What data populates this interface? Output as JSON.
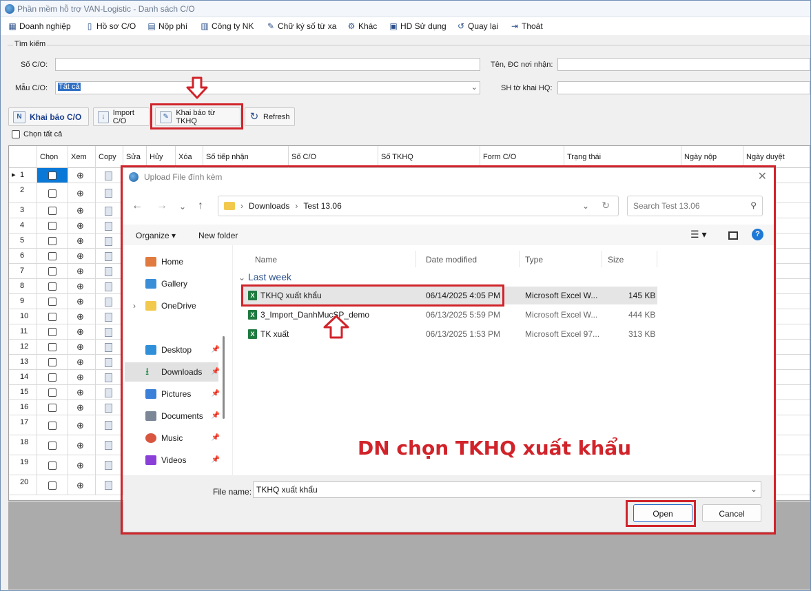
{
  "app": {
    "title": "Phần mềm hỗ trợ VAN-Logistic - Danh sách C/O",
    "menu": [
      "Doanh nghiệp",
      "Hồ sơ C/O",
      "Nộp phí",
      "Công ty NK",
      "Chữ ký số từ xa",
      "Khác",
      "HD Sử dụng",
      "Quay lại",
      "Thoát"
    ]
  },
  "search": {
    "legend": "Tìm kiếm",
    "so_co_label": "Số C/O:",
    "mau_co_label": "Mẫu C/O:",
    "mau_co_value": "Tất cả",
    "ten_dc_label": "Tên, ĐC nơi nhận:",
    "sh_tokhai_label": "SH tờ khai HQ:"
  },
  "toolbar": {
    "khai_bao": "Khai báo C/O",
    "import": "Import C/O",
    "khai_bao_tkhq": "Khai báo từ TKHQ",
    "refresh": "Refresh",
    "chon_tat_ca": "Chọn tất cả"
  },
  "grid": {
    "columns": [
      "Chọn",
      "Xem",
      "Copy",
      "Sửa",
      "Hủy",
      "Xóa",
      "Số tiếp nhận",
      "Số C/O",
      "Số TKHQ",
      "Form C/O",
      "Trạng thái",
      "Ngày nộp",
      "Ngày duyệt"
    ],
    "rows": [
      "1",
      "2",
      "3",
      "4",
      "5",
      "6",
      "7",
      "8",
      "9",
      "10",
      "11",
      "12",
      "13",
      "14",
      "15",
      "16",
      "17",
      "18",
      "19",
      "20"
    ]
  },
  "dialog": {
    "title": "Upload File đính kèm",
    "path": [
      "Downloads",
      "Test 13.06"
    ],
    "search_placeholder": "Search Test 13.06",
    "organize": "Organize",
    "new_folder": "New folder",
    "nav": [
      {
        "label": "Home",
        "icon": "home-icon"
      },
      {
        "label": "Gallery",
        "icon": "gallery-icon"
      },
      {
        "label": "OneDrive",
        "icon": "folder-icon"
      },
      {
        "label": "Desktop",
        "icon": "desktop-icon"
      },
      {
        "label": "Downloads",
        "icon": "download-icon"
      },
      {
        "label": "Pictures",
        "icon": "pictures-icon"
      },
      {
        "label": "Documents",
        "icon": "documents-icon"
      },
      {
        "label": "Music",
        "icon": "music-icon"
      },
      {
        "label": "Videos",
        "icon": "videos-icon"
      }
    ],
    "columns": [
      "Name",
      "Date modified",
      "Type",
      "Size"
    ],
    "group": "Last week",
    "files": [
      {
        "name": "TKHQ xuất khẩu",
        "date": "06/14/2025 4:05 PM",
        "type": "Microsoft Excel W...",
        "size": "145 KB"
      },
      {
        "name": "3_Import_DanhMucSP_demo",
        "date": "06/13/2025 5:59 PM",
        "type": "Microsoft Excel W...",
        "size": "444 KB"
      },
      {
        "name": "TK xuất",
        "date": "06/13/2025 1:53 PM",
        "type": "Microsoft Excel 97...",
        "size": "313 KB"
      }
    ],
    "file_name_label": "File name:",
    "file_name_value": "TKHQ xuất khẩu",
    "open": "Open",
    "cancel": "Cancel"
  },
  "annotation": "DN chọn TKHQ xuất khẩu",
  "colors": {
    "highlight": "#d1232a",
    "selection": "#0a78d7",
    "group_header": "#2a4f8a"
  }
}
